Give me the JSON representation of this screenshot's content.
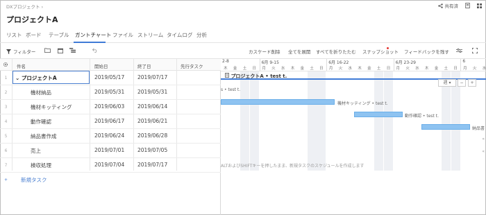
{
  "breadcrumb": "DXプロジェクト",
  "topbar": {
    "share": "共有済",
    "icons": [
      "share-icon",
      "document-icon",
      "grid-icon"
    ]
  },
  "page_title": "プロジェクトA",
  "tabs": [
    "リスト",
    "ボード",
    "テーブル",
    "ガントチャート",
    "ファイル",
    "ストリーム",
    "タイムログ",
    "分析"
  ],
  "toolbar": {
    "filter": "フィルター",
    "cascade": "カスケード削除",
    "expand_all": "全てを展開",
    "collapse_all": "すべてを折りたたむ",
    "snapshot": "スナップショット",
    "feedback": "フィードバックを残す"
  },
  "grid": {
    "headers": [
      "件名",
      "開始日",
      "終了日",
      "先行タスク"
    ],
    "rows": [
      {
        "num": "1",
        "name": "プロジェクトA",
        "start": "2019/05/17",
        "end": "2019/07/17",
        "pred": ""
      },
      {
        "num": "2",
        "name": "機材納品",
        "start": "2019/05/31",
        "end": "2019/05/31",
        "pred": ""
      },
      {
        "num": "3",
        "name": "機材キッティング",
        "start": "2019/06/03",
        "end": "2019/06/14",
        "pred": ""
      },
      {
        "num": "4",
        "name": "動作確認",
        "start": "2019/06/17",
        "end": "2019/06/21",
        "pred": ""
      },
      {
        "num": "5",
        "name": "納品書作成",
        "start": "2019/06/24",
        "end": "2019/06/28",
        "pred": ""
      },
      {
        "num": "6",
        "name": "売上",
        "start": "2019/07/01",
        "end": "2019/07/05",
        "pred": ""
      },
      {
        "num": "7",
        "name": "検収処理",
        "start": "2019/07/04",
        "end": "2019/07/17",
        "pred": ""
      }
    ],
    "add_task": "新規タスク"
  },
  "gantt": {
    "weeks": [
      "2-8",
      "6月 9-15",
      "6月 16-22",
      "6月 23-29",
      "6"
    ],
    "days": [
      "月",
      "火",
      "水",
      "木",
      "金",
      "土",
      "日"
    ],
    "summary_label": "プロジェクトA • test t.",
    "bar_labels": {
      "row2": "s • test t.",
      "row3": "機材キッティング • test t.",
      "row4": "動作確認 • test t.",
      "row5": "納品書"
    },
    "zoom_level": "週",
    "hint": "ALTおよびSHIFTキーを押したまま、新規タスクのスケジュールを作成します"
  }
}
